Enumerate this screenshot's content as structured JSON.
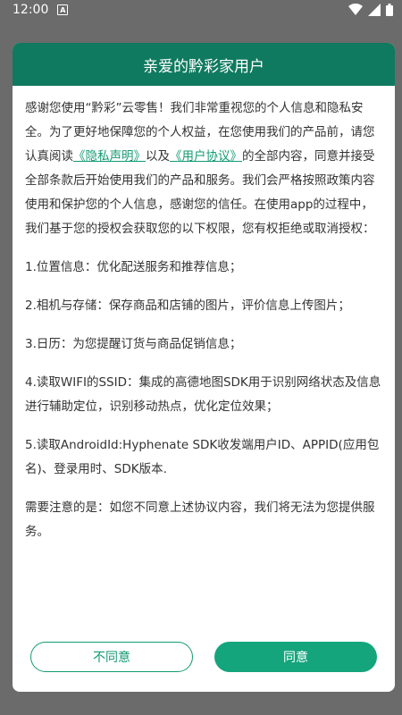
{
  "status_bar": {
    "time": "12:00",
    "notif_letter": "A"
  },
  "dialog": {
    "title": "亲爱的黔彩家用户",
    "intro_before_link1": "感谢您使用“黔彩”云零售！我们非常重视您的个人信息和隐私安全。为了更好地保障您的个人权益，在您使用我们的产品前，请您认真阅读",
    "privacy_link": "《隐私声明》",
    "intro_between": "以及",
    "agreement_link": "《用户协议》",
    "intro_after_link2": "的全部内容，同意并接受全部条款后开始使用我们的产品和服务。我们会严格按照政策内容使用和保护您的个人信息，感谢您的信任。在使用app的过程中，我们基于您的授权会获取您的以下权限，您有权拒绝或取消授权：",
    "items": [
      "1.位置信息：优化配送服务和推荐信息；",
      "2.相机与存储：保存商品和店铺的图片，评价信息上传图片；",
      "3.日历：为您提醒订货与商品促销信息；",
      "4.读取WIFI的SSID：集成的高德地图SDK用于识别网络状态及信息进行辅助定位，识别移动热点，优化定位效果；",
      "5.读取AndroidId:Hyphenate SDK收发端用户ID、APPID(应用包名)、登录用时、SDK版本."
    ],
    "note": "需要注意的是：如您不同意上述协议内容，我们将无法为您提供服务。",
    "disagree_label": "不同意",
    "agree_label": "同意"
  },
  "colors": {
    "accent": "#139a72",
    "header": "#0f7a5f",
    "overlay": "#6b6b6b"
  }
}
